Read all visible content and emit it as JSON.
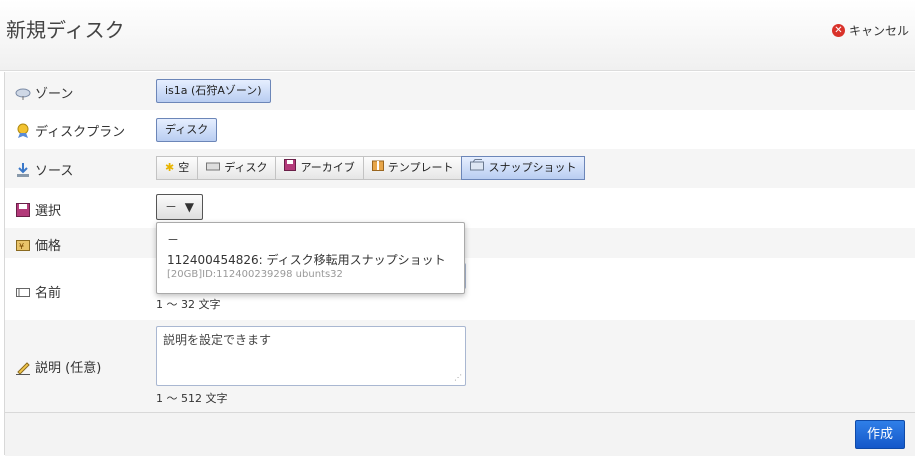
{
  "header": {
    "title": "新規ディスク",
    "cancel_label": "キャンセル"
  },
  "zone": {
    "label": "ゾーン",
    "button": "is1a (石狩Aゾーン)"
  },
  "plan": {
    "label": "ディスクプラン",
    "button": "ディスク"
  },
  "source": {
    "label": "ソース",
    "options": [
      "空",
      "ディスク",
      "アーカイブ",
      "テンプレート",
      "スナップショット"
    ],
    "selected": "スナップショット"
  },
  "select": {
    "label": "選択",
    "current": "－",
    "dropdown": {
      "options": [
        {
          "title": "－"
        },
        {
          "title": "112400454826: ディスク移転用スナップショット",
          "sub": "[20GB]ID:112400239298 ubunts32"
        }
      ]
    }
  },
  "price": {
    "label": "価格"
  },
  "name": {
    "label": "名前",
    "hint": "1 ～ 32 文字"
  },
  "description": {
    "label": "説明 (任意)",
    "placeholder": "説明を設定できます",
    "hint": "1 ～ 512 文字"
  },
  "footer": {
    "create_label": "作成"
  },
  "colors": {
    "accent": "#1a5fd0",
    "selected_bg": "#c4d6f5",
    "cancel_icon": "#d9322a"
  }
}
